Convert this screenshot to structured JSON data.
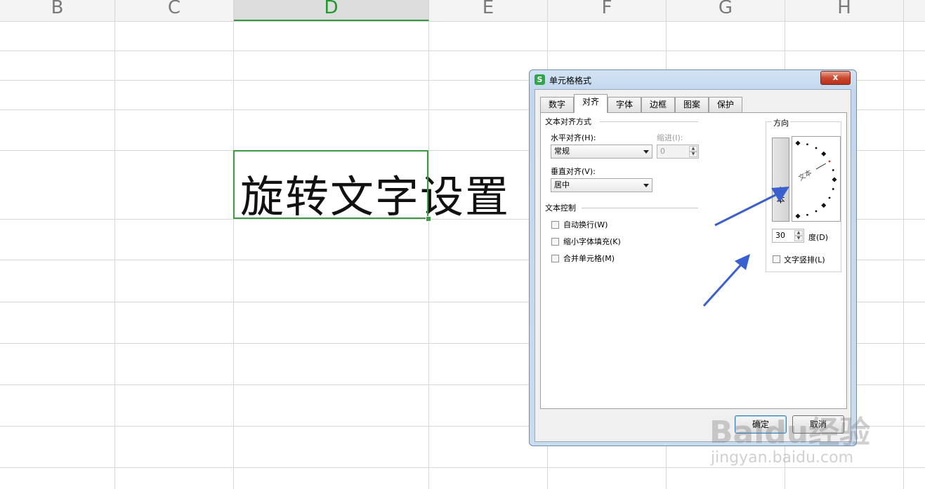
{
  "sheet": {
    "columns": [
      "B",
      "C",
      "D",
      "E",
      "F",
      "G",
      "H"
    ],
    "selected_column": "D",
    "cell_text": "旋转文字设置"
  },
  "dialog": {
    "title": "单元格格式",
    "logo": "S",
    "close": "x",
    "tabs": [
      "数字",
      "对齐",
      "字体",
      "边框",
      "图案",
      "保护"
    ],
    "active_tab": "对齐",
    "alignment": {
      "section_title": "文本对齐方式",
      "horizontal_label": "水平对齐(H):",
      "horizontal_value": "常规",
      "indent_label": "缩进(I):",
      "indent_value": "0",
      "vertical_label": "垂直对齐(V):",
      "vertical_value": "居中"
    },
    "text_control": {
      "section_title": "文本控制",
      "options": [
        "自动换行(W)",
        "缩小字体填充(K)",
        "合并单元格(M)"
      ]
    },
    "orientation": {
      "section_title": "方向",
      "vertical_text": "文本",
      "dial_text": "文本",
      "angle_degrees": 30,
      "angle_value": "30",
      "degree_label": "度(D)",
      "vertical_checkbox_label": "文字竖排(L)"
    },
    "buttons": {
      "ok": "确定",
      "cancel": "取消"
    }
  },
  "watermark": {
    "brand": "Baidu经验",
    "url": "jingyan.baidu.com"
  },
  "colors": {
    "selection_green": "#3d9c43",
    "arrow_blue": "#3a5fcf",
    "dial_red": "#c0392b"
  },
  "icons": [
    "arrow-annotation-icon",
    "checkbox-icon",
    "dropdown-arrow-icon",
    "spinner-icon",
    "close-icon",
    "app-logo-icon"
  ]
}
